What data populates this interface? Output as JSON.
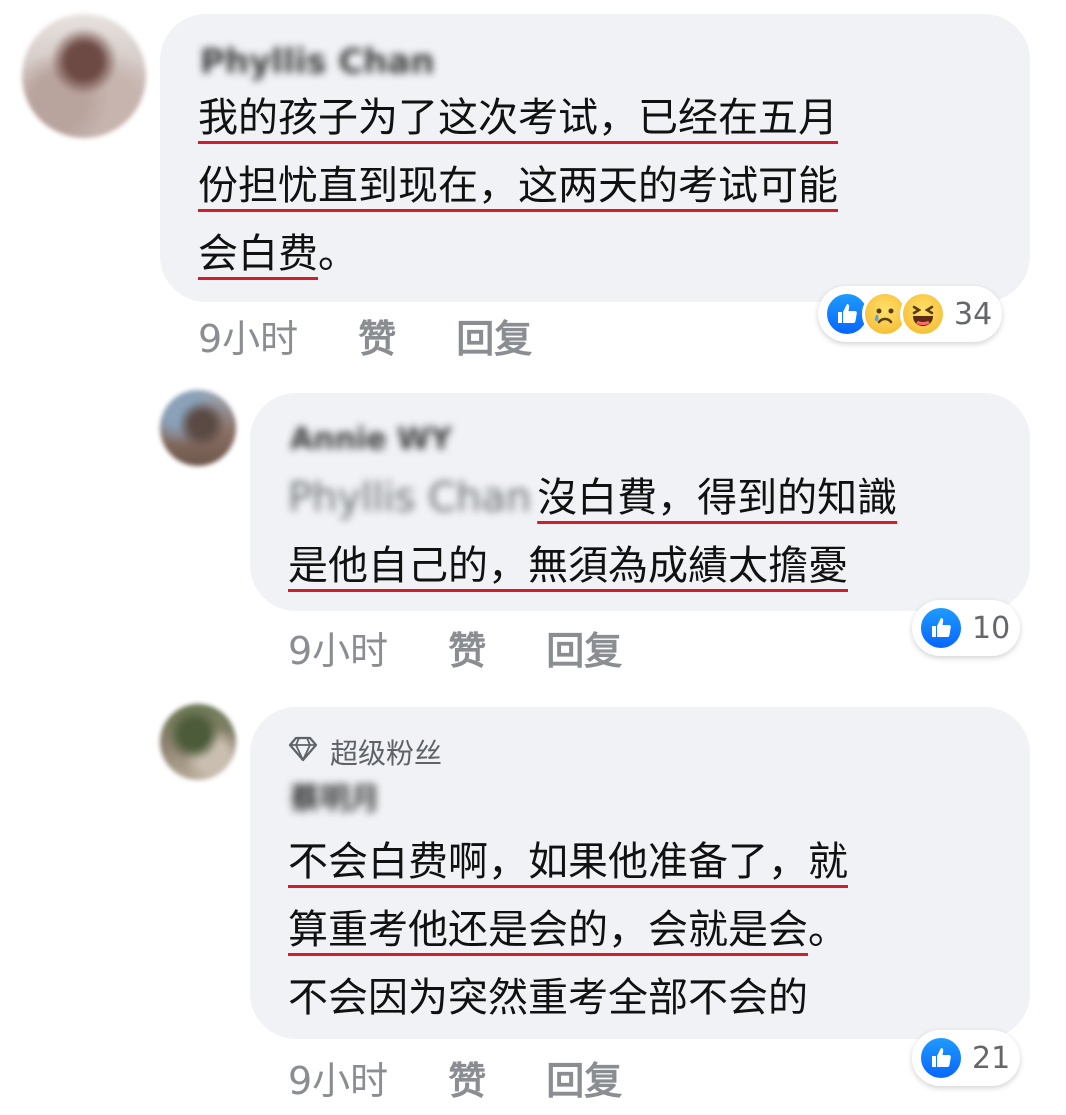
{
  "comments": [
    {
      "author": "Phyllis Chan",
      "lines": [
        "我的孩子为了这次考试，已经在五月",
        "份担忧直到现在，这两天的考试可能",
        "会白费"
      ],
      "line3_tail": "。",
      "time": "9小时",
      "like_label": "赞",
      "reply_label": "回复",
      "reaction_count": "34"
    },
    {
      "author": "Annie WY",
      "mention": "Phyllis Chan",
      "lines": [
        "沒白費，得到的知識",
        "是他自己的，無須為成績太擔憂"
      ],
      "time": "9小时",
      "like_label": "赞",
      "reply_label": "回复",
      "reaction_count": "10"
    },
    {
      "badge": "超级粉丝",
      "author": "蔡明月",
      "lines": [
        "不会白费啊，如果他准备了，就",
        "算重考他还是会的，会就是会",
        "不会因为突然重考全部不会的"
      ],
      "line2_tail": "。",
      "time": "9小时",
      "like_label": "赞",
      "reply_label": "回复",
      "reaction_count": "21"
    }
  ],
  "icons": {
    "like": "like-icon",
    "sad": "sad-face-icon",
    "haha": "laugh-face-icon",
    "badge": "diamond-icon"
  },
  "colors": {
    "bubble": "#f0f2f5",
    "underline": "#d01e2a",
    "like_blue": "#0866ff",
    "meta": "#8a8d91"
  }
}
